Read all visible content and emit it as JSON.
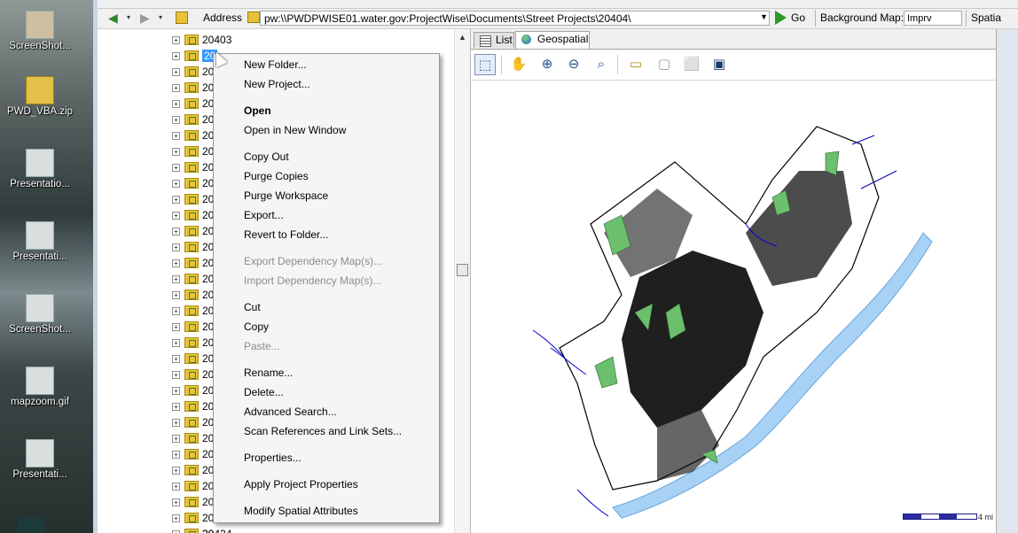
{
  "desktop": {
    "icons": [
      {
        "label": "ScreenShot..."
      },
      {
        "label": "PWD_VBA.zip"
      },
      {
        "label": "Presentatio..."
      },
      {
        "label": "Presentati..."
      },
      {
        "label": "ScreenShot..."
      },
      {
        "label": "mapzoom.gif"
      },
      {
        "label": "Presentati..."
      }
    ]
  },
  "addressbar": {
    "address_label": "Address",
    "address_value": "pw:\\\\PWDPWISE01.water.gov:ProjectWise\\Documents\\Street Projects\\20404\\",
    "go_label": "Go",
    "background_map_label": "Background Map:",
    "background_map_value": "Imprv",
    "spatial_label": "Spatia"
  },
  "tree": {
    "top_item": "20403",
    "selected_item": "20",
    "rows": [
      "20",
      "20",
      "20",
      "20",
      "20",
      "20",
      "20",
      "20",
      "20",
      "20",
      "20",
      "20",
      "20",
      "20",
      "20",
      "20",
      "20",
      "20",
      "20",
      "20",
      "20",
      "20",
      "20",
      "20",
      "20",
      "20",
      "20",
      "20",
      "20",
      "20"
    ],
    "bottom_item": "20424"
  },
  "tabs": {
    "list_label": "List",
    "geospatial_label": "Geospatial"
  },
  "map": {
    "scale_label": "4 mi",
    "colors": {
      "land": "#ffffff",
      "streets": "#000000",
      "water": "#a8d2f5",
      "parks": "#6cbf6c",
      "boundary": "#0000cc"
    }
  },
  "context_menu": {
    "new_folder": "New Folder...",
    "new_project": "New Project...",
    "open": "Open",
    "open_new_window": "Open in New Window",
    "copy_out": "Copy Out",
    "purge_copies": "Purge Copies",
    "purge_workspace": "Purge Workspace",
    "export": "Export...",
    "revert_to_folder": "Revert to Folder...",
    "export_dependency": "Export Dependency Map(s)...",
    "import_dependency": "Import Dependency Map(s)...",
    "cut": "Cut",
    "copy": "Copy",
    "paste": "Paste...",
    "rename": "Rename...",
    "delete": "Delete...",
    "advanced_search": "Advanced Search...",
    "scan_references": "Scan References and Link Sets...",
    "properties": "Properties...",
    "apply_project_properties": "Apply Project Properties",
    "modify_spatial_attributes": "Modify Spatial Attributes"
  }
}
